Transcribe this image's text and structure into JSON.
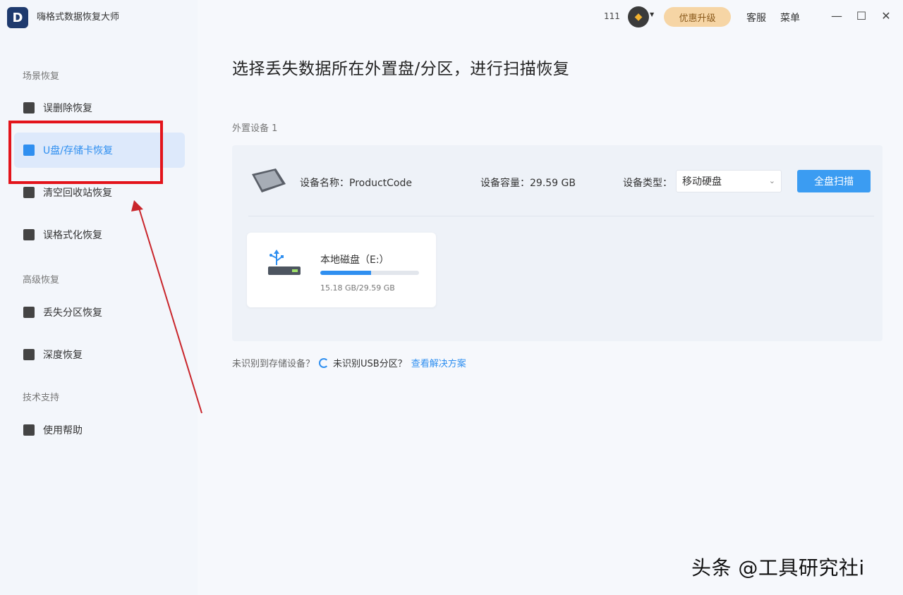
{
  "app": {
    "logo_letter": "D",
    "title": "嗨格式数据恢复大师"
  },
  "topbar": {
    "count": "111",
    "vip_icon": "diamond-icon",
    "upgrade_label": "优惠升级",
    "service_label": "客服",
    "menu_label": "菜单",
    "minimize": "—",
    "maximize": "☐",
    "close": "✕"
  },
  "sidebar": {
    "sections": [
      {
        "label": "场景恢复"
      },
      {
        "label": "高级恢复"
      },
      {
        "label": "技术支持"
      }
    ],
    "items": [
      {
        "label": "误删除恢复",
        "icon": "file-icon"
      },
      {
        "label": "U盘/存储卡恢复",
        "icon": "usb-icon",
        "active": true
      },
      {
        "label": "清空回收站恢复",
        "icon": "trash-icon"
      },
      {
        "label": "误格式化恢复",
        "icon": "broom-icon"
      },
      {
        "label": "丢失分区恢复",
        "icon": "partition-icon"
      },
      {
        "label": "深度恢复",
        "icon": "deep-scan-icon"
      },
      {
        "label": "使用帮助",
        "icon": "help-book-icon"
      }
    ]
  },
  "main": {
    "title": "选择丢失数据所在外置盘/分区，进行扫描恢复",
    "device_count": "外置设备 1",
    "device": {
      "name_label": "设备名称：",
      "name_value": "ProductCode",
      "capacity_label": "设备容量：",
      "capacity_value": "29.59 GB",
      "type_label": "设备类型：",
      "type_value": "移动硬盘",
      "scan_label": "全盘扫描"
    },
    "partition": {
      "name": "本地磁盘（E:）",
      "used_fraction": 0.513,
      "size_text": "15.18 GB/29.59 GB"
    },
    "help": {
      "question": "未识别到存储设备？",
      "usb_text": "未识别USB分区？",
      "link": "查看解决方案"
    }
  },
  "watermark": "头条 @工具研究社i",
  "colors": {
    "accent": "#2f8ff0",
    "highlight": "#e3141b",
    "upgrade_bg": "#f6d5a5"
  }
}
